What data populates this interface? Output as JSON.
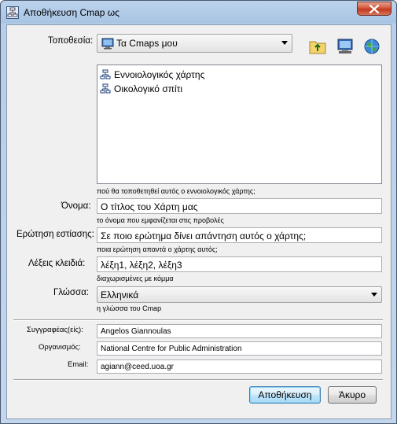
{
  "window": {
    "title": "Αποθήκευση Cmap ως",
    "close_icon": "close-icon",
    "app_icon": "cmap-icon"
  },
  "location": {
    "label": "Τοποθεσία:",
    "selected": "Τα Cmaps μου",
    "icons": [
      "folder-up-icon",
      "new-folder-icon",
      "network-places-icon"
    ]
  },
  "files": {
    "items": [
      {
        "label": "Εννοιολογικός χάρτης",
        "icon": "cmap-file-icon"
      },
      {
        "label": "Οικολογικό σπίτι",
        "icon": "cmap-file-icon"
      }
    ],
    "hint": "πού θα τοποθετηθεί αυτός ο εννοιολογικός χάρτης;"
  },
  "name": {
    "label": "Όνομα:",
    "value": "Ο τίτλος του Χάρτη μας",
    "hint": "το όνομα που εμφανίζεται στις προβολές"
  },
  "focus_question": {
    "label": "Ερώτηση εστίασης:",
    "value": "Σε ποιο ερώτημα δίνει απάντηση αυτός ο χάρτης;",
    "hint": "ποια ερώτηση απαντά ο χάρτης αυτός;"
  },
  "keywords": {
    "label": "Λέξεις κλειδιά:",
    "value": "λέξη1, λέξη2, λέξη3",
    "hint": "διαχωρισμένες με κόμμα"
  },
  "language": {
    "label": "Γλώσσα:",
    "selected": "Ελληνικά",
    "hint": "η γλώσσα του Cmap"
  },
  "authors": {
    "label": "Συγγραφέας(είς):",
    "value": "Angelos Giannoulas"
  },
  "organization": {
    "label": "Οργανισμός:",
    "value": "National Centre for Public Administration"
  },
  "email": {
    "label": "Email:",
    "value": "agiann@ceed.uoa.gr"
  },
  "buttons": {
    "save": "Αποθήκευση",
    "cancel": "Άκυρο"
  }
}
